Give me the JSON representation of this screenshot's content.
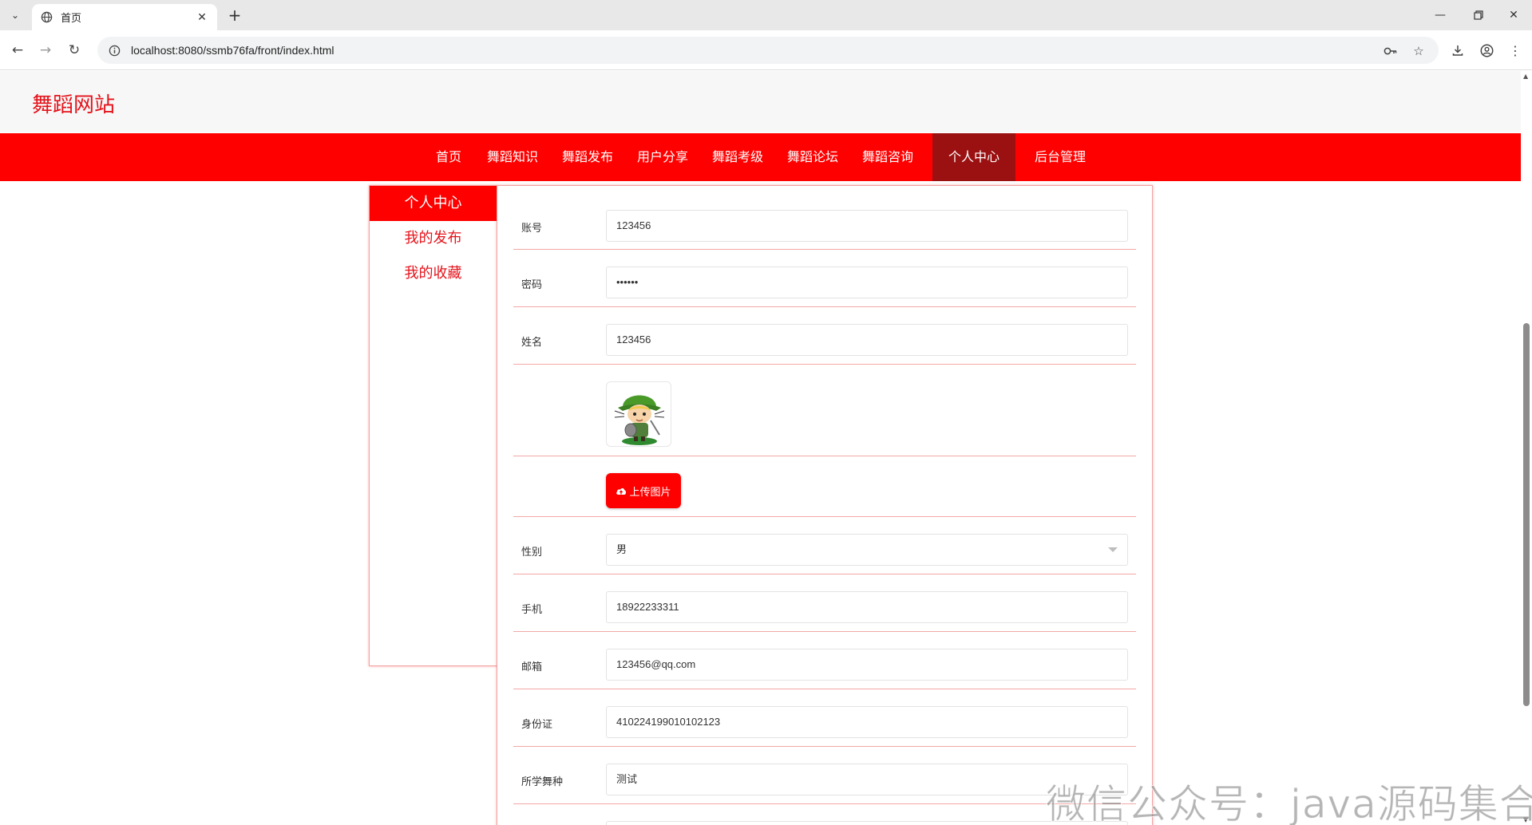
{
  "browser": {
    "tab_title": "首页",
    "url": "localhost:8080/ssmb76fa/front/index.html"
  },
  "site": {
    "logo": "舞蹈网站"
  },
  "nav": {
    "items": [
      "首页",
      "舞蹈知识",
      "舞蹈发布",
      "用户分享",
      "舞蹈考级",
      "舞蹈论坛",
      "舞蹈咨询",
      "个人中心",
      "后台管理"
    ],
    "active": "个人中心"
  },
  "sidebar": {
    "items": [
      "个人中心",
      "我的发布",
      "我的收藏"
    ],
    "active": "个人中心"
  },
  "form": {
    "account_label": "账号",
    "account_value": "123456",
    "password_label": "密码",
    "password_value": "••••••",
    "name_label": "姓名",
    "name_value": "123456",
    "upload_label": "上传图片",
    "gender_label": "性别",
    "gender_value": "男",
    "phone_label": "手机",
    "phone_value": "18922233311",
    "email_label": "邮箱",
    "email_value": "123456@qq.com",
    "idcard_label": "身份证",
    "idcard_value": "410224199010102123",
    "dance_label": "所学舞种",
    "dance_value": "测试"
  },
  "watermark": "微信公众号：java源码集合",
  "colors": {
    "brand_red": "#ff0000",
    "nav_active": "#9b1111",
    "logo_red": "#e4131b",
    "row_divider": "#f3a7a7"
  },
  "icons": [
    "tab-list-icon",
    "globe-icon",
    "close-icon",
    "plus-icon",
    "back-icon",
    "forward-icon",
    "reload-icon",
    "info-icon",
    "key-icon",
    "star-icon",
    "download-icon",
    "profile-icon",
    "menu-icon",
    "cloud-upload-icon",
    "avatar-image"
  ]
}
